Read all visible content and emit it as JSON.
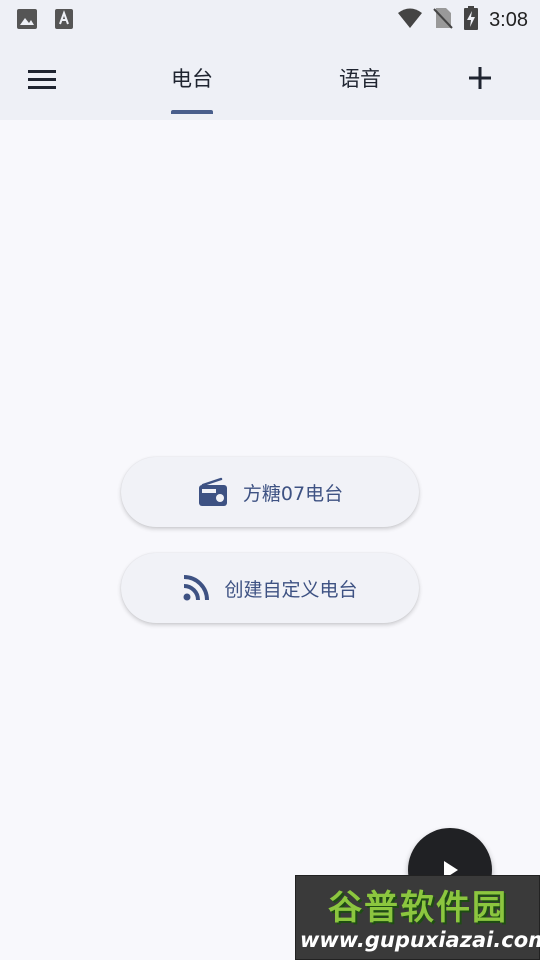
{
  "status_bar": {
    "time": "3:08",
    "left_icons": [
      "image-icon",
      "text-a-icon"
    ],
    "right_icons": [
      "wifi-icon",
      "no-sim-icon",
      "battery-charging-icon"
    ]
  },
  "app_bar": {
    "menu_icon": "menu-icon",
    "tabs": [
      {
        "label": "电台",
        "selected": true
      },
      {
        "label": "语音",
        "selected": false
      }
    ],
    "add_icon": "plus-icon"
  },
  "actions": [
    {
      "label": "方糖07电台",
      "icon": "radio-icon"
    },
    {
      "label": "创建自定义电台",
      "icon": "rss-icon"
    }
  ],
  "fab": {
    "icon": "play-icon"
  },
  "watermark": {
    "title": "谷普软件园",
    "url": "www.gupuxiazai.com"
  },
  "colors": {
    "accent": "#4a5f8c",
    "button_text": "#3e5283",
    "background": "#f8f8fc",
    "bar": "#eef0f6"
  }
}
